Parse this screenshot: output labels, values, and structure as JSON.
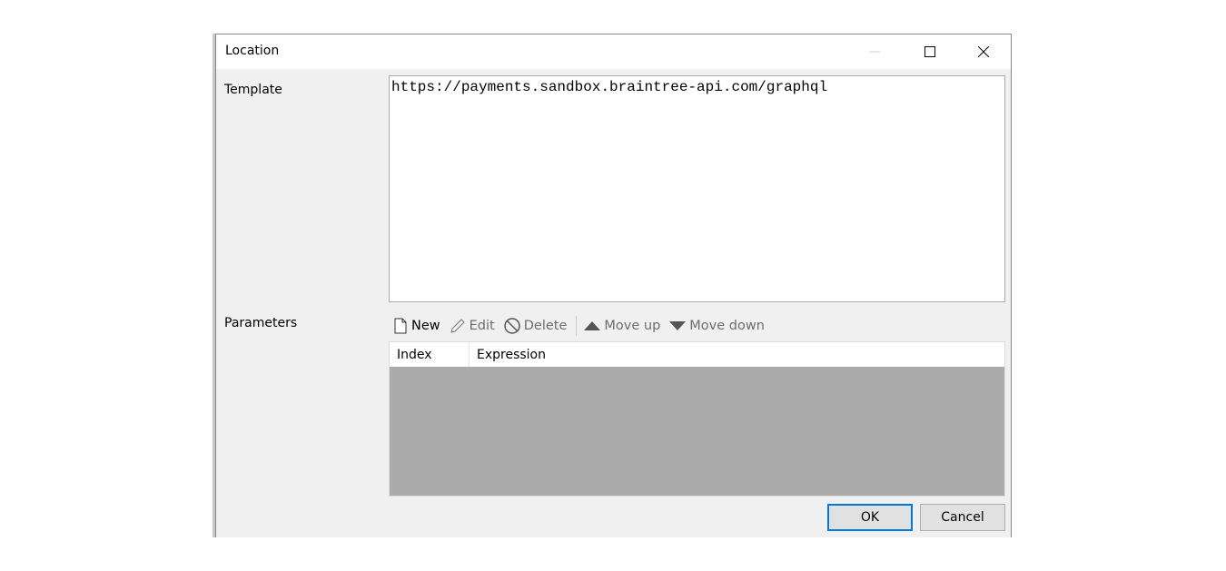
{
  "window": {
    "title": "Location"
  },
  "template": {
    "label": "Template",
    "value": "https://payments.sandbox.braintree-api.com/graphql"
  },
  "parameters": {
    "label": "Parameters",
    "toolbar": [
      {
        "label": "New",
        "icon": "new-file-icon",
        "enabled": true
      },
      {
        "label": "Edit",
        "icon": "pencil-icon",
        "enabled": false
      },
      {
        "label": "Delete",
        "icon": "prohibited-icon",
        "enabled": false
      },
      {
        "label": "Move up",
        "icon": "triangle-up-icon",
        "enabled": false
      },
      {
        "label": "Move down",
        "icon": "triangle-down-icon",
        "enabled": false
      }
    ],
    "columns": [
      "Index",
      "Expression"
    ],
    "rows": []
  },
  "buttons": {
    "ok": "OK",
    "cancel": "Cancel"
  }
}
